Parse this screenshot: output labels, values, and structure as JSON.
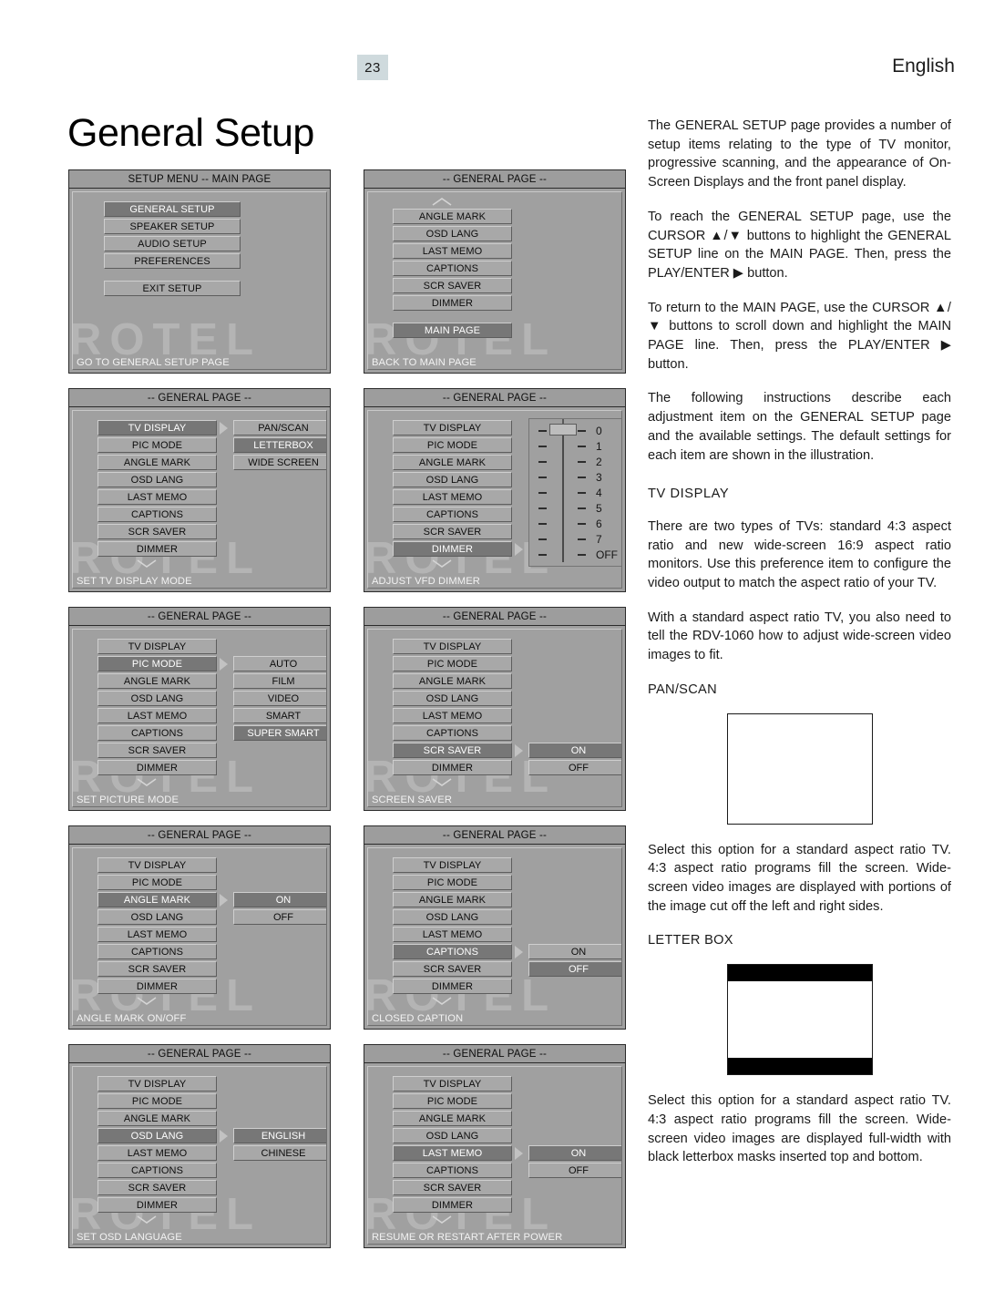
{
  "header": {
    "page_number": "23",
    "language": "English",
    "title": "General Setup"
  },
  "body_text": {
    "p1": "The GENERAL SETUP page provides a number of setup items relating to the type of TV monitor, progressive scanning, and the appearance of On-Screen Displays and the front panel display.",
    "p2": "To reach the GENERAL SETUP page, use the CURSOR ▲/▼ buttons to highlight the GENERAL SETUP line on the MAIN PAGE. Then, press the PLAY/ENTER ▶ button.",
    "p3": "To return to the MAIN PAGE, use the CURSOR ▲/▼ buttons to scroll down and highlight the MAIN PAGE line. Then, press the PLAY/ENTER ▶ button.",
    "p4": "The following instructions describe each adjustment item on the GENERAL SETUP page and the available settings. The default settings for each item are shown in the illustration.",
    "tv_display_heading": "TV DISPLAY",
    "p5": "There are two types of TVs: standard 4:3 aspect ratio and new wide-screen 16:9 aspect ratio monitors. Use this preference item to configure the video output to match the aspect ratio of your TV.",
    "p6": "With a standard aspect ratio TV, you also need to tell the RDV-1060 how to adjust wide-screen video images to fit.",
    "panscan_heading": "PAN/SCAN",
    "p7": "Select this option for a standard aspect ratio TV. 4:3 aspect ratio programs fill the screen. Wide-screen video images are displayed with portions of the image cut off the left and right sides.",
    "letterbox_heading": "LETTER BOX",
    "p8": "Select this option for a standard aspect ratio TV. 4:3 aspect ratio programs fill the screen. Wide-screen video images are displayed full-width with black letterbox masks inserted top and bottom."
  },
  "screens": [
    {
      "id": "setup-main-page",
      "title": "SETUP MENU -- MAIN PAGE",
      "status": "GO TO GENERAL SETUP PAGE",
      "watermark": "ROTEL",
      "menu": [
        {
          "label": "GENERAL SETUP",
          "selected": true
        },
        {
          "label": "SPEAKER SETUP",
          "selected": false
        },
        {
          "label": "AUDIO SETUP",
          "selected": false
        },
        {
          "label": "PREFERENCES",
          "selected": false
        }
      ],
      "menu_extra": [
        {
          "label": "EXIT SETUP",
          "selected": false
        }
      ]
    },
    {
      "id": "general-page-main-page",
      "title": "-- GENERAL PAGE --",
      "status": "BACK TO MAIN PAGE",
      "watermark": "ROTEL",
      "scroll_up": true,
      "menu": [
        {
          "label": "ANGLE MARK",
          "selected": false
        },
        {
          "label": "OSD LANG",
          "selected": false
        },
        {
          "label": "LAST MEMO",
          "selected": false
        },
        {
          "label": "CAPTIONS",
          "selected": false
        },
        {
          "label": "SCR SAVER",
          "selected": false
        },
        {
          "label": "DIMMER",
          "selected": false
        }
      ],
      "menu_extra": [
        {
          "label": "MAIN PAGE",
          "selected": true
        }
      ]
    },
    {
      "id": "general-page-tv-display",
      "title": "-- GENERAL PAGE --",
      "status": "SET TV DISPLAY MODE",
      "watermark": "ROTEL",
      "scroll_down": true,
      "menu": [
        {
          "label": "TV DISPLAY",
          "selected": true
        },
        {
          "label": "PIC MODE",
          "selected": false
        },
        {
          "label": "ANGLE MARK",
          "selected": false
        },
        {
          "label": "OSD LANG",
          "selected": false
        },
        {
          "label": "LAST MEMO",
          "selected": false
        },
        {
          "label": "CAPTIONS",
          "selected": false
        },
        {
          "label": "SCR SAVER",
          "selected": false
        },
        {
          "label": "DIMMER",
          "selected": false
        }
      ],
      "options": [
        {
          "label": "PAN/SCAN",
          "selected": false
        },
        {
          "label": "LETTERBOX",
          "selected": true
        },
        {
          "label": "WIDE SCREEN",
          "selected": false
        }
      ],
      "options_anchor_index": 0
    },
    {
      "id": "general-page-dimmer",
      "title": "-- GENERAL PAGE --",
      "status": "ADJUST VFD DIMMER",
      "watermark": "ROTEL",
      "scroll_down": true,
      "menu": [
        {
          "label": "TV DISPLAY",
          "selected": false
        },
        {
          "label": "PIC MODE",
          "selected": false
        },
        {
          "label": "ANGLE MARK",
          "selected": false
        },
        {
          "label": "OSD LANG",
          "selected": false
        },
        {
          "label": "LAST MEMO",
          "selected": false
        },
        {
          "label": "CAPTIONS",
          "selected": false
        },
        {
          "label": "SCR SAVER",
          "selected": false
        },
        {
          "label": "DIMMER",
          "selected": true
        }
      ],
      "slider": {
        "levels": [
          "0",
          "1",
          "2",
          "3",
          "4",
          "5",
          "6",
          "7",
          "OFF"
        ],
        "value": "0"
      },
      "options_anchor_index": 7
    },
    {
      "id": "general-page-pic-mode",
      "title": "-- GENERAL PAGE --",
      "status": "SET PICTURE MODE",
      "watermark": "ROTEL",
      "scroll_down": true,
      "menu": [
        {
          "label": "TV DISPLAY",
          "selected": false
        },
        {
          "label": "PIC MODE",
          "selected": true
        },
        {
          "label": "ANGLE MARK",
          "selected": false
        },
        {
          "label": "OSD LANG",
          "selected": false
        },
        {
          "label": "LAST MEMO",
          "selected": false
        },
        {
          "label": "CAPTIONS",
          "selected": false
        },
        {
          "label": "SCR SAVER",
          "selected": false
        },
        {
          "label": "DIMMER",
          "selected": false
        }
      ],
      "options": [
        {
          "label": "AUTO",
          "selected": false
        },
        {
          "label": "FILM",
          "selected": false
        },
        {
          "label": "VIDEO",
          "selected": false
        },
        {
          "label": "SMART",
          "selected": false
        },
        {
          "label": "SUPER SMART",
          "selected": true
        }
      ],
      "options_anchor_index": 1
    },
    {
      "id": "general-page-scr-saver",
      "title": "-- GENERAL PAGE --",
      "status": "SCREEN SAVER",
      "watermark": "ROTEL",
      "scroll_down": true,
      "menu": [
        {
          "label": "TV DISPLAY",
          "selected": false
        },
        {
          "label": "PIC MODE",
          "selected": false
        },
        {
          "label": "ANGLE MARK",
          "selected": false
        },
        {
          "label": "OSD LANG",
          "selected": false
        },
        {
          "label": "LAST MEMO",
          "selected": false
        },
        {
          "label": "CAPTIONS",
          "selected": false
        },
        {
          "label": "SCR SAVER",
          "selected": true
        },
        {
          "label": "DIMMER",
          "selected": false
        }
      ],
      "options": [
        {
          "label": "ON",
          "selected": true
        },
        {
          "label": "OFF",
          "selected": false
        }
      ],
      "options_anchor_index": 6
    },
    {
      "id": "general-page-angle-mark",
      "title": "-- GENERAL PAGE --",
      "status": "ANGLE MARK ON/OFF",
      "watermark": "ROTEL",
      "scroll_down": true,
      "menu": [
        {
          "label": "TV DISPLAY",
          "selected": false
        },
        {
          "label": "PIC MODE",
          "selected": false
        },
        {
          "label": "ANGLE MARK",
          "selected": true
        },
        {
          "label": "OSD LANG",
          "selected": false
        },
        {
          "label": "LAST MEMO",
          "selected": false
        },
        {
          "label": "CAPTIONS",
          "selected": false
        },
        {
          "label": "SCR SAVER",
          "selected": false
        },
        {
          "label": "DIMMER",
          "selected": false
        }
      ],
      "options": [
        {
          "label": "ON",
          "selected": true
        },
        {
          "label": "OFF",
          "selected": false
        }
      ],
      "options_anchor_index": 2
    },
    {
      "id": "general-page-captions",
      "title": "-- GENERAL PAGE --",
      "status": "CLOSED CAPTION",
      "watermark": "ROTEL",
      "scroll_down": true,
      "menu": [
        {
          "label": "TV DISPLAY",
          "selected": false
        },
        {
          "label": "PIC MODE",
          "selected": false
        },
        {
          "label": "ANGLE MARK",
          "selected": false
        },
        {
          "label": "OSD LANG",
          "selected": false
        },
        {
          "label": "LAST MEMO",
          "selected": false
        },
        {
          "label": "CAPTIONS",
          "selected": true
        },
        {
          "label": "SCR SAVER",
          "selected": false
        },
        {
          "label": "DIMMER",
          "selected": false
        }
      ],
      "options": [
        {
          "label": "ON",
          "selected": false
        },
        {
          "label": "OFF",
          "selected": true
        }
      ],
      "options_anchor_index": 5
    },
    {
      "id": "general-page-osd-lang",
      "title": "-- GENERAL PAGE --",
      "status": "SET OSD LANGUAGE",
      "watermark": "ROTEL",
      "scroll_down": true,
      "menu": [
        {
          "label": "TV DISPLAY",
          "selected": false
        },
        {
          "label": "PIC MODE",
          "selected": false
        },
        {
          "label": "ANGLE MARK",
          "selected": false
        },
        {
          "label": "OSD LANG",
          "selected": true
        },
        {
          "label": "LAST MEMO",
          "selected": false
        },
        {
          "label": "CAPTIONS",
          "selected": false
        },
        {
          "label": "SCR SAVER",
          "selected": false
        },
        {
          "label": "DIMMER",
          "selected": false
        }
      ],
      "options": [
        {
          "label": "ENGLISH",
          "selected": true
        },
        {
          "label": "CHINESE",
          "selected": false
        }
      ],
      "options_anchor_index": 3
    },
    {
      "id": "general-page-last-memo",
      "title": "-- GENERAL PAGE --",
      "status": "RESUME OR RESTART AFTER POWER",
      "watermark": "ROTEL",
      "scroll_down": true,
      "menu": [
        {
          "label": "TV DISPLAY",
          "selected": false
        },
        {
          "label": "PIC MODE",
          "selected": false
        },
        {
          "label": "ANGLE MARK",
          "selected": false
        },
        {
          "label": "OSD LANG",
          "selected": false
        },
        {
          "label": "LAST MEMO",
          "selected": true
        },
        {
          "label": "CAPTIONS",
          "selected": false
        },
        {
          "label": "SCR SAVER",
          "selected": false
        },
        {
          "label": "DIMMER",
          "selected": false
        }
      ],
      "options": [
        {
          "label": "ON",
          "selected": true
        },
        {
          "label": "OFF",
          "selected": false
        }
      ],
      "options_anchor_index": 4
    }
  ]
}
